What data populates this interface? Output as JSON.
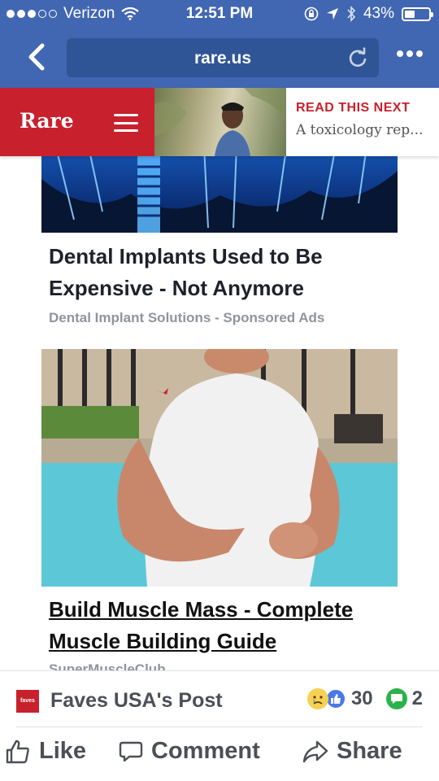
{
  "status_bar": {
    "carrier": "Verizon",
    "time": "12:51 PM",
    "battery": "43%",
    "battery_level": 0.43
  },
  "browser": {
    "url": "rare.us"
  },
  "site_header": {
    "brand": "Rare",
    "read_next_title": "READ THIS NEXT",
    "read_next_teaser": "A toxicology rep..."
  },
  "ads": [
    {
      "title": "Dental Implants Used to Be Expensive - Not Anymore",
      "source": "Dental Implant Solutions - Sponsored Ads"
    },
    {
      "title": "Build Muscle Mass - Complete Muscle Building Guide",
      "source": "SuperMuscleClub"
    }
  ],
  "post_bar": {
    "page_logo_text": "faves",
    "post_name": "Faves USA's Post",
    "reaction_count": "30",
    "comment_count": "2",
    "like_label": "Like",
    "comment_label": "Comment",
    "share_label": "Share"
  },
  "colors": {
    "facebook_blue": "#4267b2",
    "rare_red": "#c8202d"
  }
}
